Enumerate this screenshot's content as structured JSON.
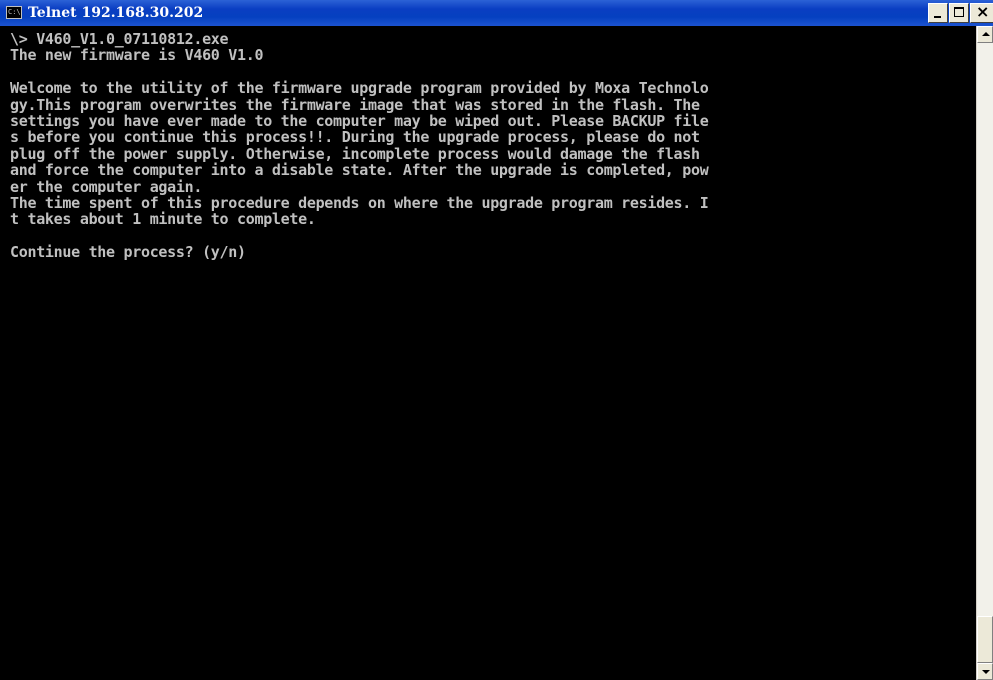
{
  "window": {
    "title": "Telnet 192.168.30.202",
    "icon": "console-icon",
    "icon_text": "C:\\"
  },
  "title_buttons": {
    "minimize": "minimize-icon",
    "maximize": "maximize-icon",
    "close": "close-icon",
    "close_glyph": "×"
  },
  "console": {
    "lines": [
      "\\> V460_V1.0_07110812.exe",
      "The new firmware is V460 V1.0",
      "",
      "Welcome to the utility of the firmware upgrade program provided by Moxa Technolo",
      "gy.This program overwrites the firmware image that was stored in the flash. The",
      "settings you have ever made to the computer may be wiped out. Please BACKUP file",
      "s before you continue this process!!. During the upgrade process, please do not",
      "plug off the power supply. Otherwise, incomplete process would damage the flash",
      "and force the computer into a disable state. After the upgrade is completed, pow",
      "er the computer again.",
      "The time spent of this procedure depends on where the upgrade program resides. I",
      "t takes about 1 minute to complete.",
      "",
      "Continue the process? (y/n)"
    ]
  },
  "scrollbar": {
    "up_icon": "arrow-up-icon",
    "down_icon": "arrow-down-icon",
    "position": 1.0
  },
  "colors": {
    "titlebar": "#0a3ec2",
    "console_bg": "#000000",
    "console_fg": "#c0c0c0"
  }
}
